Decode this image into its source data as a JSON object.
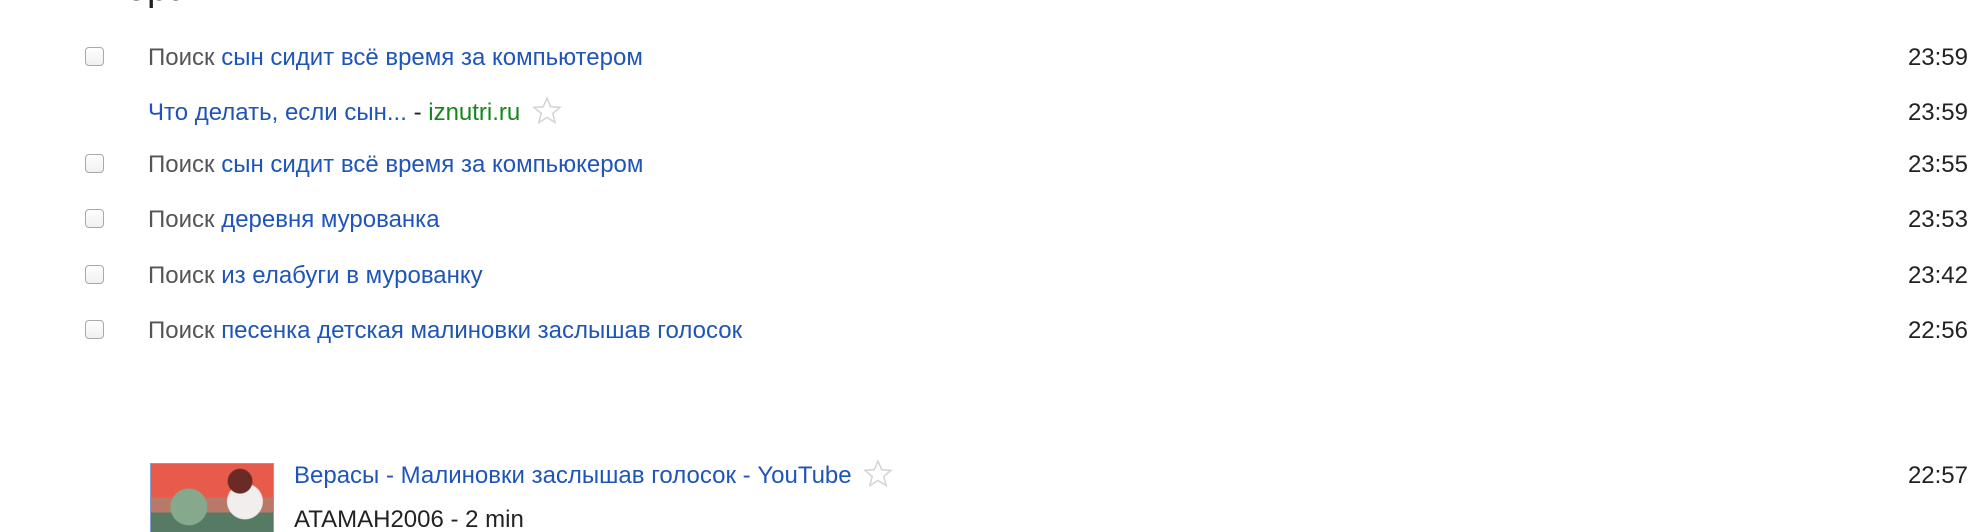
{
  "history": {
    "day_heading": "Вчера",
    "rows": [
      {
        "type": "search",
        "prefix": "Поиск",
        "query": "сын сидит всё время за компьютером",
        "time": "23:59"
      },
      {
        "type": "result",
        "title": "Что делать, если сын...",
        "separator": "-",
        "domain": "iznutri.ru",
        "star_icon": "star-outline-icon",
        "time": "23:59"
      },
      {
        "type": "search",
        "prefix": "Поиск",
        "query": "сын сидит всё время за компьюкером",
        "time": "23:55"
      },
      {
        "type": "search",
        "prefix": "Поиск",
        "query": "деревня мурованка",
        "time": "23:53"
      },
      {
        "type": "search",
        "prefix": "Поиск",
        "query": "из елабуги в мурованку",
        "time": "23:42"
      },
      {
        "type": "search",
        "prefix": "Поиск",
        "query": "песенка детская малиновки заслышав голосок",
        "time": "22:56"
      }
    ],
    "video_result": {
      "title": "Верасы - Малиновки заслышав голосок - YouTube",
      "meta": "ATAMAH2006 - 2 min",
      "star_icon": "star-outline-icon",
      "time": "22:57"
    }
  },
  "colors": {
    "link": "#1f55b8",
    "domain": "#14881b",
    "text": "#222222",
    "muted": "#555555"
  }
}
